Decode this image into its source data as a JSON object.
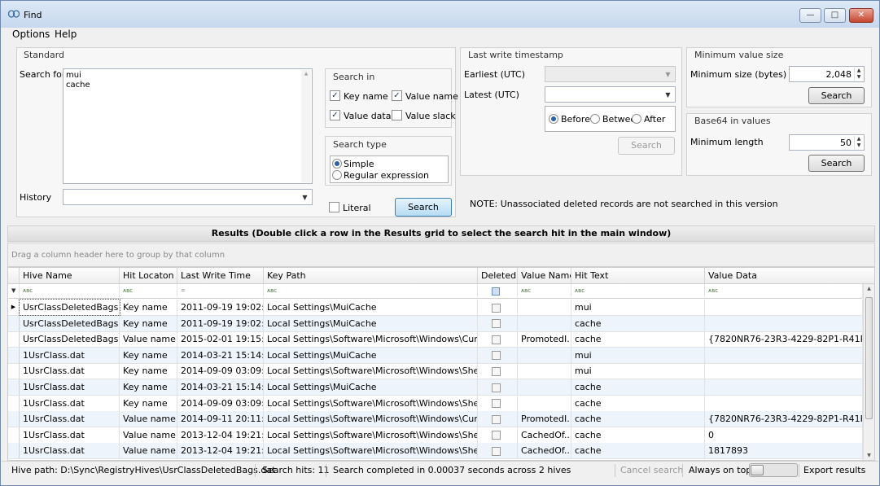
{
  "window": {
    "title": "Find"
  },
  "menu": [
    "Options",
    "Help"
  ],
  "standard": {
    "title": "Standard",
    "search_for_label": "Search for",
    "search_terms": [
      "mui",
      "cache"
    ],
    "history_label": "History",
    "history_value": "",
    "search_in": {
      "title": "Search in",
      "key_name": {
        "label": "Key name",
        "checked": true
      },
      "value_name": {
        "label": "Value name",
        "checked": true
      },
      "value_data": {
        "label": "Value data",
        "checked": true
      },
      "value_slack": {
        "label": "Value slack",
        "checked": false
      }
    },
    "search_type": {
      "title": "Search type",
      "simple": {
        "label": "Simple",
        "selected": true
      },
      "regex": {
        "label": "Regular expression",
        "selected": false
      }
    },
    "literal": {
      "label": "Literal",
      "checked": false
    },
    "search_button": "Search"
  },
  "timestamp": {
    "title": "Last write timestamp",
    "earliest_label": "Earliest (UTC)",
    "latest_label": "Latest (UTC)",
    "before": {
      "label": "Before",
      "selected": true
    },
    "between": {
      "label": "Betwee",
      "selected": false
    },
    "after": {
      "label": "After",
      "selected": false
    },
    "search_button": "Search"
  },
  "min_size": {
    "title": "Minimum value size",
    "label": "Minimum size (bytes)",
    "value": "2,048",
    "search_button": "Search"
  },
  "base64": {
    "title": "Base64 in values",
    "label": "Minimum length",
    "value": "50",
    "search_button": "Search"
  },
  "note": "NOTE: Unassociated deleted records are not searched in this version",
  "results": {
    "header": "Results (Double click a row in the Results grid to select the search hit in the main window)",
    "group_hint": "Drag a column header here to group by that column",
    "columns": [
      "Hive Name",
      "Hit Locaton",
      "Last Write Time",
      "Key Path",
      "Deleted",
      "Value Name",
      "Hit Text",
      "Value Data"
    ],
    "rows": [
      {
        "hive": "UsrClassDeletedBags.dat",
        "loc": "Key name",
        "time": "2011-09-19 19:02:08",
        "path": "Local Settings\\MuiCache",
        "deleted": false,
        "vname": "",
        "hit": "mui",
        "vdata": ""
      },
      {
        "hive": "UsrClassDeletedBags.dat",
        "loc": "Key name",
        "time": "2011-09-19 19:02:08",
        "path": "Local Settings\\MuiCache",
        "deleted": false,
        "vname": "",
        "hit": "cache",
        "vdata": ""
      },
      {
        "hive": "UsrClassDeletedBags.dat",
        "loc": "Value name",
        "time": "2015-02-01 19:15:48",
        "path": "Local Settings\\Software\\Microsoft\\Windows\\CurrentV...",
        "deleted": false,
        "vname": "PromotedI...",
        "hit": "cache",
        "vdata": "{7820NR76-23R3-4229-82P1-R41PO6..."
      },
      {
        "hive": "1UsrClass.dat",
        "loc": "Key name",
        "time": "2014-03-21 15:14:00",
        "path": "Local Settings\\MuiCache",
        "deleted": false,
        "vname": "",
        "hit": "mui",
        "vdata": ""
      },
      {
        "hive": "1UsrClass.dat",
        "loc": "Key name",
        "time": "2014-09-09 03:09:51",
        "path": "Local Settings\\Software\\Microsoft\\Windows\\Shell\\Mui...",
        "deleted": false,
        "vname": "",
        "hit": "mui",
        "vdata": ""
      },
      {
        "hive": "1UsrClass.dat",
        "loc": "Key name",
        "time": "2014-03-21 15:14:00",
        "path": "Local Settings\\MuiCache",
        "deleted": false,
        "vname": "",
        "hit": "cache",
        "vdata": ""
      },
      {
        "hive": "1UsrClass.dat",
        "loc": "Key name",
        "time": "2014-09-09 03:09:51",
        "path": "Local Settings\\Software\\Microsoft\\Windows\\Shell\\Mui...",
        "deleted": false,
        "vname": "",
        "hit": "cache",
        "vdata": ""
      },
      {
        "hive": "1UsrClass.dat",
        "loc": "Value name",
        "time": "2014-09-11 20:11:48",
        "path": "Local Settings\\Software\\Microsoft\\Windows\\CurrentV...",
        "deleted": false,
        "vname": "PromotedI...",
        "hit": "cache",
        "vdata": "{7820NR76-23R3-4229-82P1-R41PO6..."
      },
      {
        "hive": "1UsrClass.dat",
        "loc": "Value name",
        "time": "2013-12-04 19:21:41",
        "path": "Local Settings\\Software\\Microsoft\\Windows\\Shell\\Bag...",
        "deleted": false,
        "vname": "CachedOf...",
        "hit": "cache",
        "vdata": "0"
      },
      {
        "hive": "1UsrClass.dat",
        "loc": "Value name",
        "time": "2013-12-04 19:21:41",
        "path": "Local Settings\\Software\\Microsoft\\Windows\\Shell\\Ba...",
        "deleted": false,
        "vname": "CachedOf...",
        "hit": "cache",
        "vdata": "1817893"
      }
    ]
  },
  "status": {
    "hive_path": "Hive path: D:\\Sync\\RegistryHives\\UsrClassDeletedBags.dat",
    "hits": "Search hits: 11",
    "completed": "Search completed in 0.00037 seconds across 2 hives",
    "cancel": "Cancel search",
    "always_on_top": "Always on top",
    "export": "Export results"
  }
}
